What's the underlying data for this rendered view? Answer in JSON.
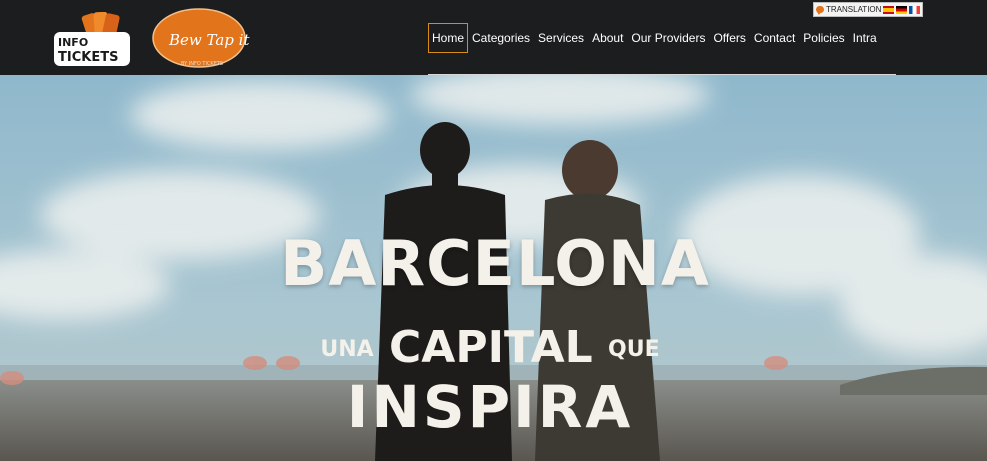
{
  "header": {
    "logo_info": {
      "top": "INFO",
      "bottom": "TICKETS"
    },
    "logo_bewtap": {
      "script": "Bew Tap it",
      "ring": "BY INFO TICKETS"
    }
  },
  "nav": {
    "items": [
      {
        "label": "Home",
        "active": true
      },
      {
        "label": "Categories"
      },
      {
        "label": "Services"
      },
      {
        "label": "About"
      },
      {
        "label": "Our Providers"
      },
      {
        "label": "Offers"
      },
      {
        "label": "Contact"
      },
      {
        "label": "Policies"
      },
      {
        "label": "Intra"
      }
    ]
  },
  "translation": {
    "label": "TRANSLATION",
    "flags": [
      "spain-flag-icon",
      "germany-flag-icon",
      "france-flag-icon"
    ]
  },
  "hero": {
    "line1": "BARCELONA",
    "line2_a": "UNA",
    "line2_b": "CAPITAL",
    "line2_c": "QUE",
    "line3": "INSPIRA"
  },
  "colors": {
    "header_bg": "#1c1d1f",
    "accent": "#d88a1b",
    "logo_orange": "#e2741b"
  }
}
